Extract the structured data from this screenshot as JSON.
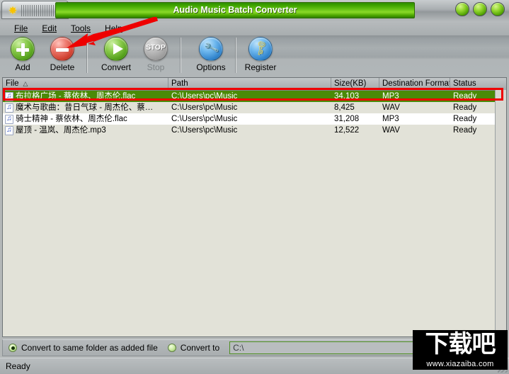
{
  "window": {
    "title": "Audio Music Batch Converter",
    "app_icon": "sun-app-icon",
    "controls": [
      {
        "name": "minimize-button",
        "label": ""
      },
      {
        "name": "maximize-button",
        "label": ""
      },
      {
        "name": "close-button",
        "label": ""
      }
    ]
  },
  "menubar": {
    "items": [
      {
        "label": "File",
        "accel": "F"
      },
      {
        "label": "Edit",
        "accel": "E"
      },
      {
        "label": "Tools",
        "accel": "T"
      },
      {
        "label": "Help",
        "accel": "H"
      }
    ]
  },
  "toolbar": {
    "items": [
      {
        "label": "Add",
        "icon": "plus-circle-icon",
        "enabled": true
      },
      {
        "label": "Delete",
        "icon": "minus-circle-icon",
        "enabled": true
      },
      {
        "label": "Convert",
        "icon": "play-circle-icon",
        "enabled": true
      },
      {
        "label": "Stop",
        "icon": "stop-circle-icon",
        "enabled": false,
        "badge": "STOP"
      },
      {
        "label": "Options",
        "icon": "wrench-circle-icon",
        "enabled": true,
        "glyph": "🔧"
      },
      {
        "label": "Register",
        "icon": "key-circle-icon",
        "enabled": true,
        "glyph": "🗝"
      }
    ]
  },
  "list": {
    "columns": [
      {
        "label": "File",
        "sort": "△"
      },
      {
        "label": "Path",
        "sort": ""
      },
      {
        "label": "Size(KB)",
        "sort": ""
      },
      {
        "label": "Destination Format",
        "sort": ""
      },
      {
        "label": "Status",
        "sort": ""
      }
    ],
    "rows": [
      {
        "file": "布拉格广场 - 蔡依林、周杰伦.flac",
        "path": "C:\\Users\\pc\\Music",
        "size": "34,103",
        "format": "MP3",
        "status": "Ready",
        "selected": true
      },
      {
        "file": "魔术与歌曲：昔日气球 - 周杰伦、蔡…",
        "path": "C:\\Users\\pc\\Music",
        "size": "8,425",
        "format": "WAV",
        "status": "Ready",
        "selected": false
      },
      {
        "file": "骑士精神 - 蔡依林、周杰伦.flac",
        "path": "C:\\Users\\pc\\Music",
        "size": "31,208",
        "format": "MP3",
        "status": "Ready",
        "selected": false
      },
      {
        "file": "屋顶 - 温岚、周杰伦.mp3",
        "path": "C:\\Users\\pc\\Music",
        "size": "12,522",
        "format": "WAV",
        "status": "Ready",
        "selected": false
      }
    ]
  },
  "output_options": {
    "same_folder_label": "Convert to same folder as added file",
    "same_folder_selected": true,
    "convert_to_label": "Convert to",
    "convert_to_selected": false,
    "path_value": "C:\\",
    "path_placeholder": ""
  },
  "statusbar": {
    "text": "Ready"
  },
  "watermark": {
    "chinese": "下载吧",
    "url": "www.xiazaiba.com"
  },
  "annotations": {
    "arrow_color": "#ee0000",
    "rect_color": "#ee0000"
  },
  "colors": {
    "title_green": "#6ec81a",
    "selected_row": "#4a8a08",
    "alt_row": "#e2e2d8",
    "chrome_gray": "#b0b5b7"
  }
}
